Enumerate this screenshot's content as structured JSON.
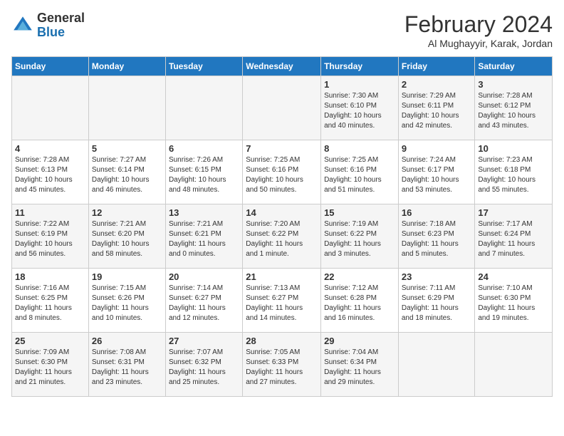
{
  "header": {
    "logo_general": "General",
    "logo_blue": "Blue",
    "title": "February 2024",
    "subtitle": "Al Mughayyir, Karak, Jordan"
  },
  "days_of_week": [
    "Sunday",
    "Monday",
    "Tuesday",
    "Wednesday",
    "Thursday",
    "Friday",
    "Saturday"
  ],
  "weeks": [
    [
      {
        "day": "",
        "info": ""
      },
      {
        "day": "",
        "info": ""
      },
      {
        "day": "",
        "info": ""
      },
      {
        "day": "",
        "info": ""
      },
      {
        "day": "1",
        "info": "Sunrise: 7:30 AM\nSunset: 6:10 PM\nDaylight: 10 hours\nand 40 minutes."
      },
      {
        "day": "2",
        "info": "Sunrise: 7:29 AM\nSunset: 6:11 PM\nDaylight: 10 hours\nand 42 minutes."
      },
      {
        "day": "3",
        "info": "Sunrise: 7:28 AM\nSunset: 6:12 PM\nDaylight: 10 hours\nand 43 minutes."
      }
    ],
    [
      {
        "day": "4",
        "info": "Sunrise: 7:28 AM\nSunset: 6:13 PM\nDaylight: 10 hours\nand 45 minutes."
      },
      {
        "day": "5",
        "info": "Sunrise: 7:27 AM\nSunset: 6:14 PM\nDaylight: 10 hours\nand 46 minutes."
      },
      {
        "day": "6",
        "info": "Sunrise: 7:26 AM\nSunset: 6:15 PM\nDaylight: 10 hours\nand 48 minutes."
      },
      {
        "day": "7",
        "info": "Sunrise: 7:25 AM\nSunset: 6:16 PM\nDaylight: 10 hours\nand 50 minutes."
      },
      {
        "day": "8",
        "info": "Sunrise: 7:25 AM\nSunset: 6:16 PM\nDaylight: 10 hours\nand 51 minutes."
      },
      {
        "day": "9",
        "info": "Sunrise: 7:24 AM\nSunset: 6:17 PM\nDaylight: 10 hours\nand 53 minutes."
      },
      {
        "day": "10",
        "info": "Sunrise: 7:23 AM\nSunset: 6:18 PM\nDaylight: 10 hours\nand 55 minutes."
      }
    ],
    [
      {
        "day": "11",
        "info": "Sunrise: 7:22 AM\nSunset: 6:19 PM\nDaylight: 10 hours\nand 56 minutes."
      },
      {
        "day": "12",
        "info": "Sunrise: 7:21 AM\nSunset: 6:20 PM\nDaylight: 10 hours\nand 58 minutes."
      },
      {
        "day": "13",
        "info": "Sunrise: 7:21 AM\nSunset: 6:21 PM\nDaylight: 11 hours\nand 0 minutes."
      },
      {
        "day": "14",
        "info": "Sunrise: 7:20 AM\nSunset: 6:22 PM\nDaylight: 11 hours\nand 1 minute."
      },
      {
        "day": "15",
        "info": "Sunrise: 7:19 AM\nSunset: 6:22 PM\nDaylight: 11 hours\nand 3 minutes."
      },
      {
        "day": "16",
        "info": "Sunrise: 7:18 AM\nSunset: 6:23 PM\nDaylight: 11 hours\nand 5 minutes."
      },
      {
        "day": "17",
        "info": "Sunrise: 7:17 AM\nSunset: 6:24 PM\nDaylight: 11 hours\nand 7 minutes."
      }
    ],
    [
      {
        "day": "18",
        "info": "Sunrise: 7:16 AM\nSunset: 6:25 PM\nDaylight: 11 hours\nand 8 minutes."
      },
      {
        "day": "19",
        "info": "Sunrise: 7:15 AM\nSunset: 6:26 PM\nDaylight: 11 hours\nand 10 minutes."
      },
      {
        "day": "20",
        "info": "Sunrise: 7:14 AM\nSunset: 6:27 PM\nDaylight: 11 hours\nand 12 minutes."
      },
      {
        "day": "21",
        "info": "Sunrise: 7:13 AM\nSunset: 6:27 PM\nDaylight: 11 hours\nand 14 minutes."
      },
      {
        "day": "22",
        "info": "Sunrise: 7:12 AM\nSunset: 6:28 PM\nDaylight: 11 hours\nand 16 minutes."
      },
      {
        "day": "23",
        "info": "Sunrise: 7:11 AM\nSunset: 6:29 PM\nDaylight: 11 hours\nand 18 minutes."
      },
      {
        "day": "24",
        "info": "Sunrise: 7:10 AM\nSunset: 6:30 PM\nDaylight: 11 hours\nand 19 minutes."
      }
    ],
    [
      {
        "day": "25",
        "info": "Sunrise: 7:09 AM\nSunset: 6:30 PM\nDaylight: 11 hours\nand 21 minutes."
      },
      {
        "day": "26",
        "info": "Sunrise: 7:08 AM\nSunset: 6:31 PM\nDaylight: 11 hours\nand 23 minutes."
      },
      {
        "day": "27",
        "info": "Sunrise: 7:07 AM\nSunset: 6:32 PM\nDaylight: 11 hours\nand 25 minutes."
      },
      {
        "day": "28",
        "info": "Sunrise: 7:05 AM\nSunset: 6:33 PM\nDaylight: 11 hours\nand 27 minutes."
      },
      {
        "day": "29",
        "info": "Sunrise: 7:04 AM\nSunset: 6:34 PM\nDaylight: 11 hours\nand 29 minutes."
      },
      {
        "day": "",
        "info": ""
      },
      {
        "day": "",
        "info": ""
      }
    ]
  ]
}
